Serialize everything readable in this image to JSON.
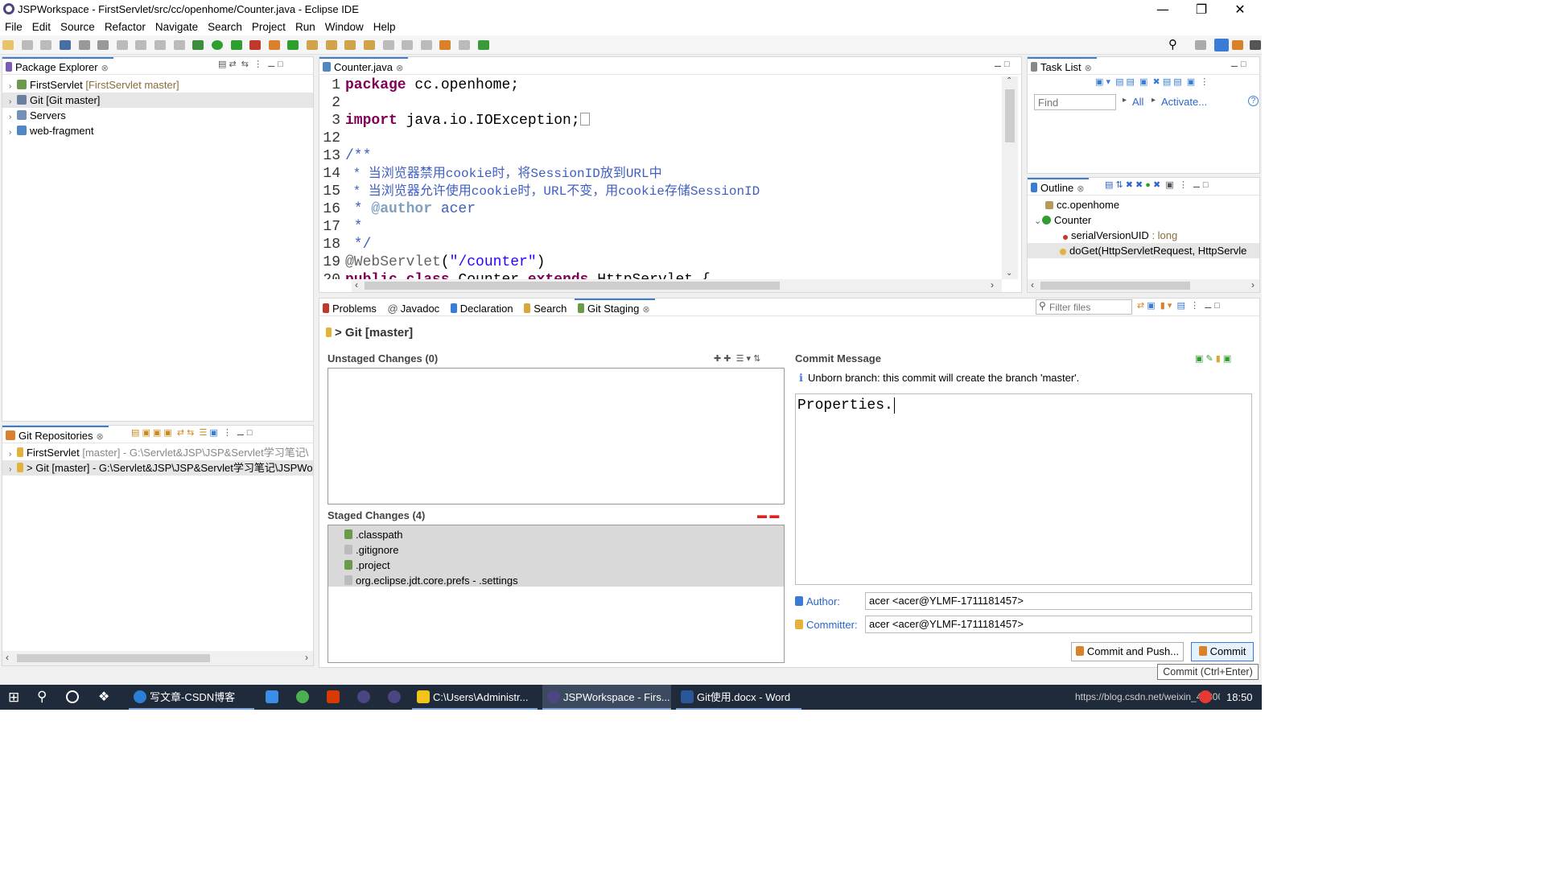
{
  "window": {
    "title": "JSPWorkspace - FirstServlet/src/cc/openhome/Counter.java - Eclipse IDE",
    "minimize": "—",
    "restore": "❐",
    "close": "✕"
  },
  "menu": [
    "File",
    "Edit",
    "Source",
    "Refactor",
    "Navigate",
    "Search",
    "Project",
    "Run",
    "Window",
    "Help"
  ],
  "package_explorer": {
    "tab": "Package Explorer",
    "items": [
      {
        "name": "FirstServlet",
        "decoration": "[FirstServlet master]"
      },
      {
        "name": "Git [Git master]",
        "decoration": ""
      },
      {
        "name": "Servers",
        "decoration": ""
      },
      {
        "name": "web-fragment",
        "decoration": ""
      }
    ]
  },
  "git_repositories": {
    "tab": "Git Repositories",
    "items": [
      {
        "name": "FirstServlet",
        "decoration": "[master] - G:\\Servlet&JSP\\JSP&Servlet学习笔记\\"
      },
      {
        "name": "> Git [master] - G:\\Servlet&JSP\\JSP&Servlet学习笔记\\JSPWo",
        "decoration": ""
      }
    ]
  },
  "editor": {
    "tab": "Counter.java",
    "lines": [
      {
        "num": "1",
        "text": "package cc.openhome;"
      },
      {
        "num": "2",
        "text": ""
      },
      {
        "num": "3",
        "text": "import java.io.IOException;"
      },
      {
        "num": "12",
        "text": ""
      },
      {
        "num": "13",
        "text": "/**"
      },
      {
        "num": "14",
        "text": " *  当浏览器禁用cookie时，将SessionID放到URL中"
      },
      {
        "num": "15",
        "text": " *  当浏览器允许使用cookie时，URL不变，用cookie存储SessionID"
      },
      {
        "num": "16",
        "text": " * @author acer"
      },
      {
        "num": "17",
        "text": " *"
      },
      {
        "num": "18",
        "text": " */"
      },
      {
        "num": "19",
        "text": "@WebServlet(\"/counter\")"
      },
      {
        "num": "20",
        "text": "public class Counter extends HttpServlet {"
      }
    ]
  },
  "task_list": {
    "tab": "Task List",
    "find_placeholder": "Find",
    "all": "All",
    "activate": "Activate..."
  },
  "outline": {
    "tab": "Outline",
    "items": [
      {
        "name": "cc.openhome",
        "type": ""
      },
      {
        "name": "Counter",
        "type": ""
      },
      {
        "name": "serialVersionUID",
        "type": " : long"
      },
      {
        "name": "doGet(HttpServletRequest, HttpServle",
        "type": ""
      }
    ]
  },
  "bottom_tabs": [
    "Problems",
    "Javadoc",
    "Declaration",
    "Search",
    "Git Staging"
  ],
  "filter_placeholder": "Filter files",
  "git_staging": {
    "repo": "> Git [master]",
    "unstaged_title": "Unstaged Changes (0)",
    "staged_title": "Staged Changes (4)",
    "staged": [
      ".classpath",
      ".gitignore",
      ".project",
      "org.eclipse.jdt.core.prefs - .settings"
    ],
    "commit_title": "Commit Message",
    "info": "Unborn branch: this commit will create the branch 'master'.",
    "message": "Properties.",
    "author_label": "Author:",
    "author": "acer <acer@YLMF-1711181457>",
    "committer_label": "Committer:",
    "committer": "acer <acer@YLMF-1711181457>",
    "commit_push": "Commit and Push...",
    "commit": "Commit",
    "tooltip": "Commit (Ctrl+Enter)"
  },
  "taskbar": {
    "items": [
      "写文章-CSDN博客",
      "C:\\Users\\Administr...",
      "JSPWorkspace - Firs...",
      "Git使用.docx - Word"
    ],
    "tray_text": "https://blog.csdn.net/weixin_43800",
    "clock": "18:50"
  },
  "colors": {
    "accent": "#3a7bd5",
    "keyword": "#7f0055",
    "string": "#2a00ff",
    "comment": "#3f5fbf",
    "taskbar": "#1f2a3a"
  }
}
